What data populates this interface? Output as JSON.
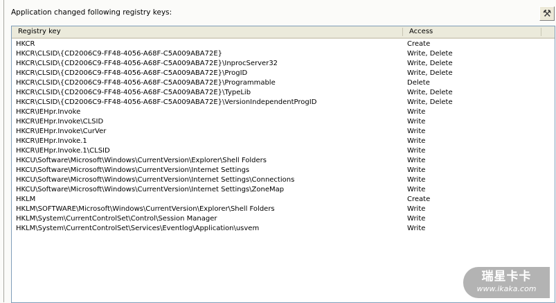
{
  "caption": "Application changed following registry keys:",
  "toolbar": {
    "tools_icon": "hammer-wrench-icon"
  },
  "columns": [
    "Registry key",
    "Access"
  ],
  "rows": [
    {
      "key": "HKCR",
      "access": "Create"
    },
    {
      "key": "HKCR\\CLSID\\{CD2006C9-FF48-4056-A68F-C5A009ABA72E}",
      "access": "Write, Delete"
    },
    {
      "key": "HKCR\\CLSID\\{CD2006C9-FF48-4056-A68F-C5A009ABA72E}\\InprocServer32",
      "access": "Write, Delete"
    },
    {
      "key": "HKCR\\CLSID\\{CD2006C9-FF48-4056-A68F-C5A009ABA72E}\\ProgID",
      "access": "Write, Delete"
    },
    {
      "key": "HKCR\\CLSID\\{CD2006C9-FF48-4056-A68F-C5A009ABA72E}\\Programmable",
      "access": "Delete"
    },
    {
      "key": "HKCR\\CLSID\\{CD2006C9-FF48-4056-A68F-C5A009ABA72E}\\TypeLib",
      "access": "Write, Delete"
    },
    {
      "key": "HKCR\\CLSID\\{CD2006C9-FF48-4056-A68F-C5A009ABA72E}\\VersionIndependentProgID",
      "access": "Write, Delete"
    },
    {
      "key": "HKCR\\IEHpr.Invoke",
      "access": "Write"
    },
    {
      "key": "HKCR\\IEHpr.Invoke\\CLSID",
      "access": "Write"
    },
    {
      "key": "HKCR\\IEHpr.Invoke\\CurVer",
      "access": "Write"
    },
    {
      "key": "HKCR\\IEHpr.Invoke.1",
      "access": "Write"
    },
    {
      "key": "HKCR\\IEHpr.Invoke.1\\CLSID",
      "access": "Write"
    },
    {
      "key": "HKCU\\Software\\Microsoft\\Windows\\CurrentVersion\\Explorer\\Shell Folders",
      "access": "Write"
    },
    {
      "key": "HKCU\\Software\\Microsoft\\Windows\\CurrentVersion\\Internet Settings",
      "access": "Write"
    },
    {
      "key": "HKCU\\Software\\Microsoft\\Windows\\CurrentVersion\\Internet Settings\\Connections",
      "access": "Write"
    },
    {
      "key": "HKCU\\Software\\Microsoft\\Windows\\CurrentVersion\\Internet Settings\\ZoneMap",
      "access": "Write"
    },
    {
      "key": "HKLM",
      "access": "Create"
    },
    {
      "key": "HKLM\\SOFTWARE\\Microsoft\\Windows\\CurrentVersion\\Explorer\\Shell Folders",
      "access": "Write"
    },
    {
      "key": "HKLM\\System\\CurrentControlSet\\Control\\Session Manager",
      "access": "Write"
    },
    {
      "key": "HKLM\\System\\CurrentControlSet\\Services\\Eventlog\\Application\\usvem",
      "access": "Write"
    }
  ],
  "watermark": {
    "name": "瑞星卡卡",
    "url": "www.ikaka.com"
  }
}
